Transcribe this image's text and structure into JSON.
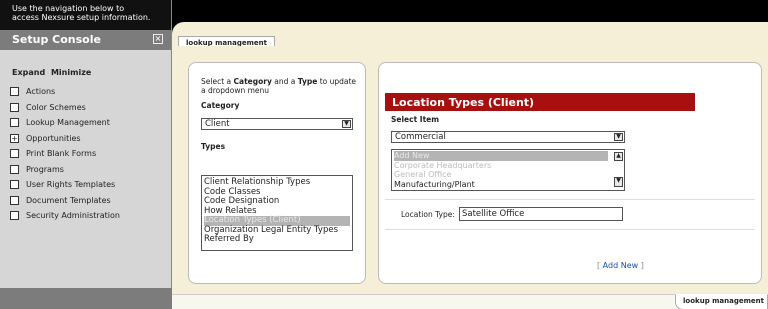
{
  "sidebar": {
    "nav_hint_line1": "Use the navigation below to",
    "nav_hint_line2": "access Nexsure setup information.",
    "title": "Setup Console",
    "close_glyph": "×",
    "expand_label": "Expand",
    "minimize_label": "Minimize",
    "items": [
      {
        "label": "Actions",
        "expanded": false
      },
      {
        "label": "Color Schemes",
        "expanded": false
      },
      {
        "label": "Lookup Management",
        "expanded": false
      },
      {
        "label": "Opportunities",
        "expanded": true,
        "marker": "+"
      },
      {
        "label": "Print Blank Forms",
        "expanded": false
      },
      {
        "label": "Programs",
        "expanded": false
      },
      {
        "label": "User Rights Templates",
        "expanded": false
      },
      {
        "label": "Document Templates",
        "expanded": false
      },
      {
        "label": "Security Administration",
        "expanded": false
      }
    ]
  },
  "tab": {
    "label": "lookup management"
  },
  "left_panel": {
    "instr_pre": "Select a ",
    "instr_cat": "Category",
    "instr_mid": " and a ",
    "instr_type": "Type",
    "instr_post": " to update",
    "instr_line2": "a dropdown menu",
    "category_label": "Category",
    "category_value": "Client",
    "types_label": "Types",
    "types": [
      "Client Relationship Types",
      "Code Classes",
      "Code Designation",
      "How Relates",
      "Location Types (Client)",
      "Organization Legal Entity Types",
      "Referred By"
    ],
    "selected_type_index": 4
  },
  "right_panel": {
    "header": "Location Types (Client)",
    "select_item_label": "Select Item",
    "select_item_value": "Commercial",
    "items": [
      "Add New",
      "Corporate Headquarters",
      "General Office",
      "Manufacturing/Plant"
    ],
    "location_type_label": "Location Type:",
    "location_type_value": "Satellite Office",
    "add_new_open": "[",
    "add_new_label": "Add New",
    "add_new_close": "]"
  },
  "bottom_tab": {
    "label": "lookup management"
  },
  "colors": {
    "header_red": "#a80f0f",
    "sidebar_gray": "#d6d6d6",
    "content_bg": "#f5efd8",
    "link_blue": "#1a4fa0"
  }
}
